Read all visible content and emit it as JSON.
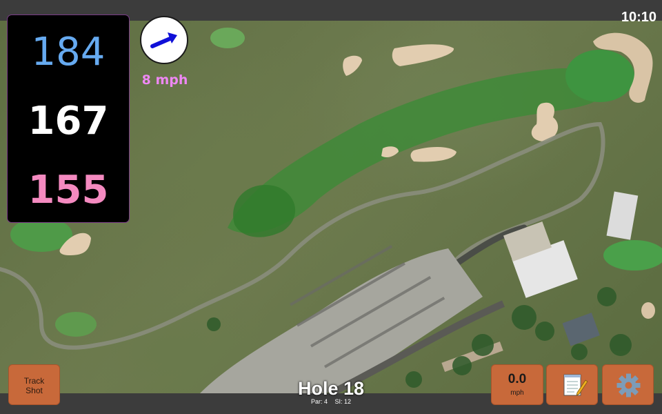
{
  "status_bar": {
    "clock": "10:10"
  },
  "distances": {
    "back": "184",
    "center": "167",
    "front": "155"
  },
  "wind": {
    "speed": "8 mph",
    "icon": "wind-arrow-icon"
  },
  "buttons": {
    "track_shot_line1": "Track",
    "track_shot_line2": "Shot",
    "speed_value": "0.0",
    "speed_unit": "mph",
    "notes_icon": "notepad-icon",
    "settings_icon": "gear-icon"
  },
  "hole": {
    "title": "Hole 18",
    "par": "Par: 4",
    "stroke_index": "SI: 12"
  },
  "colors": {
    "back_distance": "#66aaf0",
    "center_distance": "#ffffff",
    "front_distance": "#f48ac0",
    "wind_text": "#ee88f4",
    "button": "#c8693a"
  }
}
